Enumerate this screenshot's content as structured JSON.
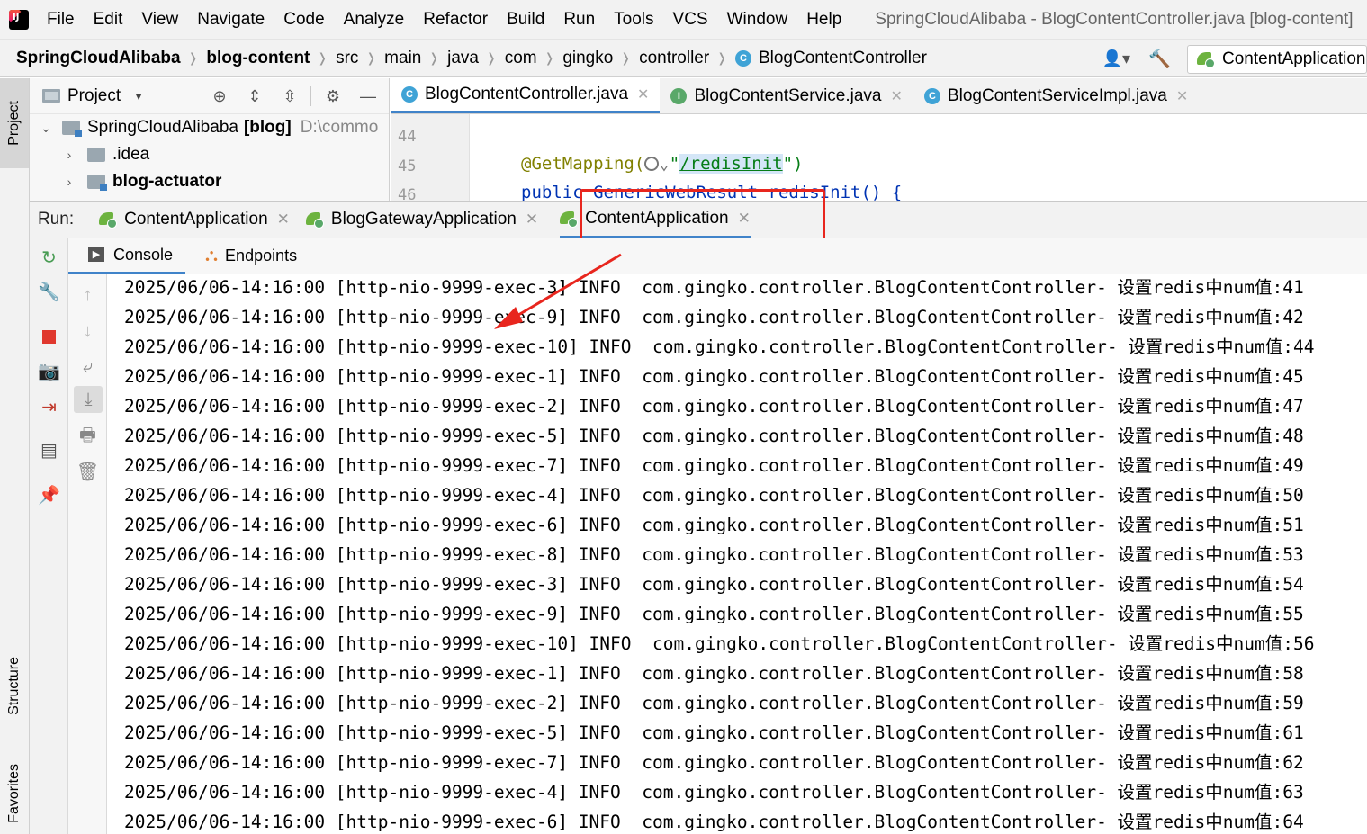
{
  "menubar": {
    "items": [
      "File",
      "Edit",
      "View",
      "Navigate",
      "Code",
      "Analyze",
      "Refactor",
      "Build",
      "Run",
      "Tools",
      "VCS",
      "Window",
      "Help"
    ],
    "window_title": "SpringCloudAlibaba - BlogContentController.java [blog-content]"
  },
  "navbar": {
    "crumbs": [
      "SpringCloudAlibaba",
      "blog-content",
      "src",
      "main",
      "java",
      "com",
      "gingko",
      "controller",
      "BlogContentController"
    ],
    "run_config": "ContentApplication"
  },
  "left_strip": {
    "project": "Project",
    "structure": "Structure",
    "favorites": "Favorites"
  },
  "project_panel": {
    "title": "Project",
    "tree": [
      {
        "name": "SpringCloudAlibaba",
        "suffix": "[blog]",
        "path": "D:\\commo"
      },
      {
        "name": ".idea"
      },
      {
        "name": "blog-actuator"
      }
    ]
  },
  "editor": {
    "tabs": [
      "BlogContentController.java",
      "BlogContentService.java",
      "BlogContentServiceImpl.java"
    ],
    "lines": [
      {
        "num": "44",
        "code": ""
      },
      {
        "num": "45",
        "annotation": "@GetMapping(",
        "string_open": "\"",
        "string_value": "/redisInit",
        "string_close": "\")"
      },
      {
        "num": "46",
        "code": "public GenericWebResult redisInit() {"
      }
    ]
  },
  "runbar": {
    "label": "Run:",
    "tabs": [
      "ContentApplication",
      "BlogGatewayApplication",
      "ContentApplication"
    ]
  },
  "console_tabs": [
    "Console",
    "Endpoints"
  ],
  "log_lines": [
    "2025/06/06-14:16:00 [http-nio-9999-exec-3] INFO  com.gingko.controller.BlogContentController- 设置redis中num值:41",
    "2025/06/06-14:16:00 [http-nio-9999-exec-9] INFO  com.gingko.controller.BlogContentController- 设置redis中num值:42",
    "2025/06/06-14:16:00 [http-nio-9999-exec-10] INFO  com.gingko.controller.BlogContentController- 设置redis中num值:44",
    "2025/06/06-14:16:00 [http-nio-9999-exec-1] INFO  com.gingko.controller.BlogContentController- 设置redis中num值:45",
    "2025/06/06-14:16:00 [http-nio-9999-exec-2] INFO  com.gingko.controller.BlogContentController- 设置redis中num值:47",
    "2025/06/06-14:16:00 [http-nio-9999-exec-5] INFO  com.gingko.controller.BlogContentController- 设置redis中num值:48",
    "2025/06/06-14:16:00 [http-nio-9999-exec-7] INFO  com.gingko.controller.BlogContentController- 设置redis中num值:49",
    "2025/06/06-14:16:00 [http-nio-9999-exec-4] INFO  com.gingko.controller.BlogContentController- 设置redis中num值:50",
    "2025/06/06-14:16:00 [http-nio-9999-exec-6] INFO  com.gingko.controller.BlogContentController- 设置redis中num值:51",
    "2025/06/06-14:16:00 [http-nio-9999-exec-8] INFO  com.gingko.controller.BlogContentController- 设置redis中num值:53",
    "2025/06/06-14:16:00 [http-nio-9999-exec-3] INFO  com.gingko.controller.BlogContentController- 设置redis中num值:54",
    "2025/06/06-14:16:00 [http-nio-9999-exec-9] INFO  com.gingko.controller.BlogContentController- 设置redis中num值:55",
    "2025/06/06-14:16:00 [http-nio-9999-exec-10] INFO  com.gingko.controller.BlogContentController- 设置redis中num值:56",
    "2025/06/06-14:16:00 [http-nio-9999-exec-1] INFO  com.gingko.controller.BlogContentController- 设置redis中num值:58",
    "2025/06/06-14:16:00 [http-nio-9999-exec-2] INFO  com.gingko.controller.BlogContentController- 设置redis中num值:59",
    "2025/06/06-14:16:00 [http-nio-9999-exec-5] INFO  com.gingko.controller.BlogContentController- 设置redis中num值:61",
    "2025/06/06-14:16:00 [http-nio-9999-exec-7] INFO  com.gingko.controller.BlogContentController- 设置redis中num值:62",
    "2025/06/06-14:16:00 [http-nio-9999-exec-4] INFO  com.gingko.controller.BlogContentController- 设置redis中num值:63",
    "2025/06/06-14:16:00 [http-nio-9999-exec-6] INFO  com.gingko.controller.BlogContentController- 设置redis中num值:64"
  ],
  "colors": {
    "highlight_box": "#e8261e",
    "active_tab_underline": "#4083c9",
    "stop_button": "#e0382e"
  }
}
